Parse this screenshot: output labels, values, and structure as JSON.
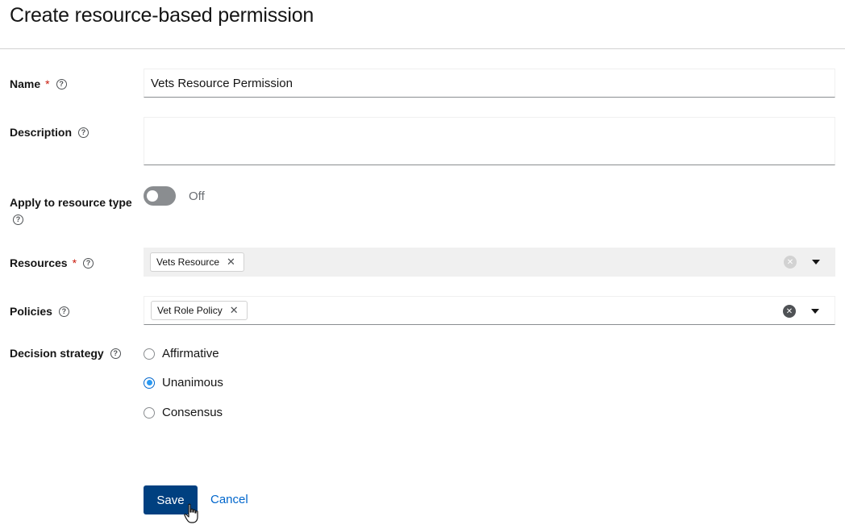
{
  "page": {
    "title": "Create resource-based permission"
  },
  "icons": {
    "help": "?",
    "chip_remove": "✕",
    "clear": "✕"
  },
  "form": {
    "name": {
      "label": "Name",
      "required_mark": "*",
      "value": "Vets Resource Permission"
    },
    "description": {
      "label": "Description",
      "value": ""
    },
    "apply_to_resource_type": {
      "label": "Apply to resource type",
      "state": "Off"
    },
    "resources": {
      "label": "Resources",
      "required_mark": "*",
      "chips": [
        "Vets Resource"
      ]
    },
    "policies": {
      "label": "Policies",
      "chips": [
        "Vet Role Policy"
      ]
    },
    "decision_strategy": {
      "label": "Decision strategy",
      "options": [
        "Affirmative",
        "Unanimous",
        "Consensus"
      ],
      "selected": "Unanimous"
    }
  },
  "actions": {
    "save": "Save",
    "cancel": "Cancel"
  },
  "colors": {
    "primary": "#004080",
    "link": "#0066cc",
    "required": "#c9190b",
    "radio_checked": "#2b9af3"
  }
}
